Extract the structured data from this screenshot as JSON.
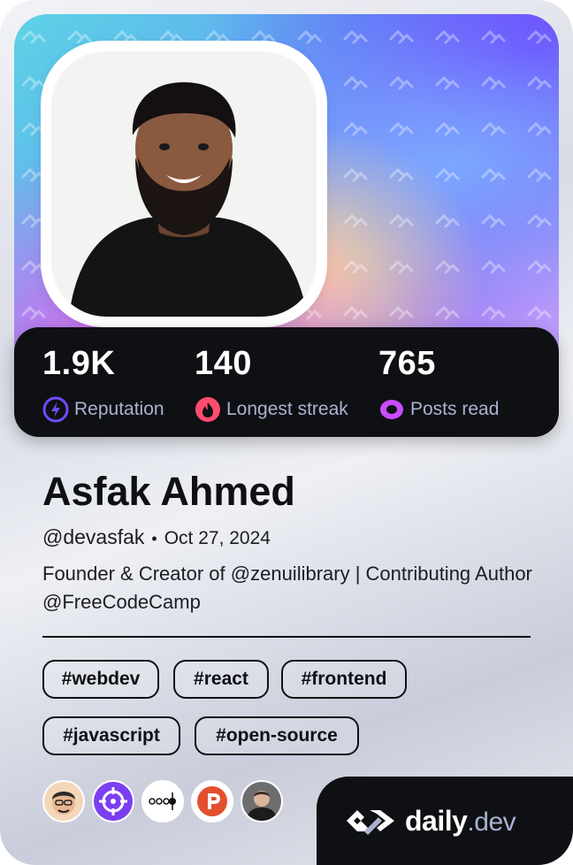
{
  "profile": {
    "name": "Asfak Ahmed",
    "handle": "@devasfak",
    "separator": "•",
    "joined": "Oct 27, 2024",
    "bio": "Founder & Creator of @zenuilibrary | Contributing Author @FreeCodeCamp"
  },
  "stats": [
    {
      "value": "1.9K",
      "label": "Reputation",
      "icon": "lightning-icon",
      "color": "#6f4cff"
    },
    {
      "value": "140",
      "label": "Longest streak",
      "icon": "flame-icon",
      "color": "#ff4c6f"
    },
    {
      "value": "765",
      "label": "Posts read",
      "icon": "eye-icon",
      "color": "#c94cff"
    }
  ],
  "tags": [
    "#webdev",
    "#react",
    "#frontend",
    "#javascript",
    "#open-source"
  ],
  "squads": [
    "squad-avatar-memoji",
    "squad-crosshair",
    "squad-network",
    "squad-p-logo",
    "squad-person"
  ],
  "brand": {
    "word": "daily",
    "tld": ".dev"
  },
  "colors": {
    "dark": "#0f1014",
    "muted": "#a8b3cf",
    "accent": "#6f4cff"
  }
}
